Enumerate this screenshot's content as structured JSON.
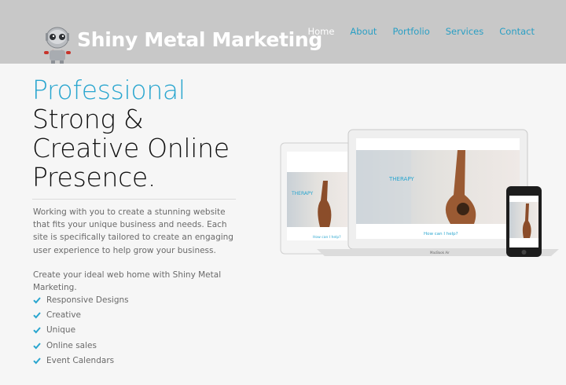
{
  "header": {
    "brand": "Shiny Metal Marketing",
    "nav": [
      {
        "label": "Home",
        "active": true
      },
      {
        "label": "About"
      },
      {
        "label": "Portfolio"
      },
      {
        "label": "Services"
      },
      {
        "label": "Contact"
      }
    ]
  },
  "hero": {
    "headline_accent": "Professional",
    "headline_lines": [
      "Strong &",
      "Creative Online",
      "Presence."
    ],
    "paragraph1": "Working with you to create a stunning website that fits your unique business and needs. Each site is specifically tailored to create an engaging user experience to help grow your business.",
    "paragraph2": "Create your ideal web home with Shiny Metal Marketing.",
    "features": [
      "Responsive Designs",
      "Creative",
      "Unique",
      "Online sales",
      "Event Calendars"
    ]
  },
  "devices": {
    "screen_heading": "THERAPY",
    "help_text": "How can I help?",
    "laptop_label": "MacBook Air"
  },
  "colors": {
    "accent": "#2aa6cf",
    "header_bg": "#c8c8c8",
    "body_bg": "#f6f6f6"
  }
}
